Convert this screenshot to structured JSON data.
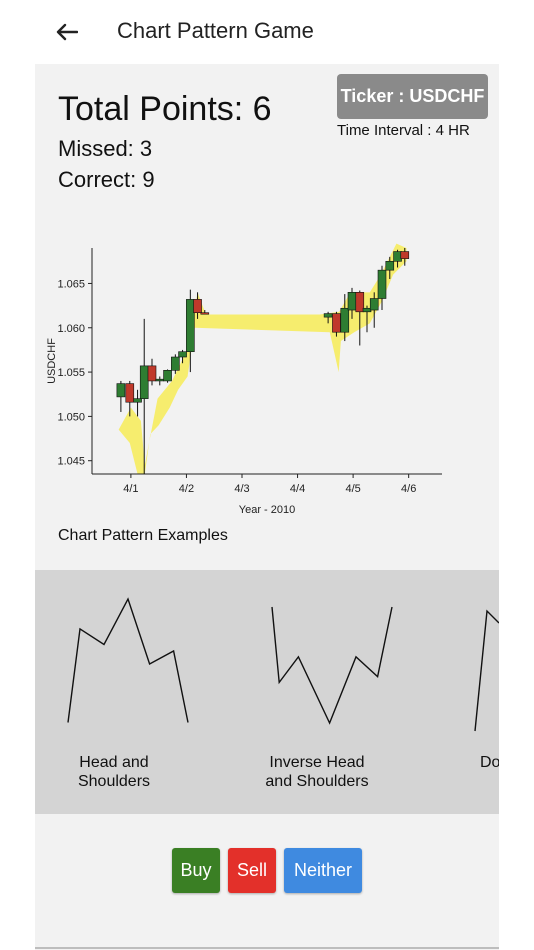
{
  "app": {
    "title": "Chart Pattern Game",
    "back_icon": "arrow-left-icon"
  },
  "score": {
    "total": "Total Points: 6",
    "missed": "Missed: 3",
    "correct": "Correct: 9"
  },
  "ticker": {
    "label": "Ticker : USDCHF",
    "interval": "Time Interval : 4 HR"
  },
  "colors": {
    "bull": "#2e7d32",
    "bear": "#c0392b",
    "highlight": "#f7ec57",
    "buy": "#3a7f24",
    "sell": "#e3302a",
    "neither": "#3f8ae0"
  },
  "chart_data": {
    "type": "candlestick",
    "xlabel": "Year - 2010",
    "ylabel": "USDCHF",
    "x_ticks": [
      "4/1",
      "4/2",
      "4/3",
      "4/4",
      "4/5",
      "4/6"
    ],
    "y_ticks": [
      "1.045",
      "1.050",
      "1.055",
      "1.060",
      "1.065"
    ],
    "ylim": [
      1.0435,
      1.069
    ],
    "xlim": [
      0.3,
      6.6
    ],
    "candles": [
      {
        "x": 0.82,
        "o": 1.0522,
        "h": 1.054,
        "l": 1.0505,
        "c": 1.0537
      },
      {
        "x": 0.98,
        "o": 1.0537,
        "h": 1.054,
        "l": 1.05,
        "c": 1.0516
      },
      {
        "x": 1.12,
        "o": 1.0516,
        "h": 1.053,
        "l": 1.05,
        "c": 1.052
      },
      {
        "x": 1.24,
        "o": 1.052,
        "h": 1.061,
        "l": 1.0435,
        "c": 1.0557
      },
      {
        "x": 1.38,
        "o": 1.0557,
        "h": 1.0565,
        "l": 1.0535,
        "c": 1.054
      },
      {
        "x": 1.52,
        "o": 1.054,
        "h": 1.0545,
        "l": 1.0535,
        "c": 1.0542
      },
      {
        "x": 1.66,
        "o": 1.054,
        "h": 1.0553,
        "l": 1.0538,
        "c": 1.0552
      },
      {
        "x": 1.8,
        "o": 1.0552,
        "h": 1.057,
        "l": 1.0548,
        "c": 1.0567
      },
      {
        "x": 1.93,
        "o": 1.0567,
        "h": 1.0575,
        "l": 1.056,
        "c": 1.0573
      },
      {
        "x": 2.07,
        "o": 1.0573,
        "h": 1.0643,
        "l": 1.055,
        "c": 1.0632
      },
      {
        "x": 2.2,
        "o": 1.0632,
        "h": 1.064,
        "l": 1.061,
        "c": 1.0617
      },
      {
        "x": 2.33,
        "o": 1.0617,
        "h": 1.062,
        "l": 1.0615,
        "c": 1.0616
      },
      {
        "x": 4.55,
        "o": 1.0612,
        "h": 1.0618,
        "l": 1.0605,
        "c": 1.0616
      },
      {
        "x": 4.7,
        "o": 1.0616,
        "h": 1.0618,
        "l": 1.059,
        "c": 1.0595
      },
      {
        "x": 4.85,
        "o": 1.0595,
        "h": 1.0638,
        "l": 1.0585,
        "c": 1.0622
      },
      {
        "x": 4.98,
        "o": 1.062,
        "h": 1.0645,
        "l": 1.061,
        "c": 1.064
      },
      {
        "x": 5.12,
        "o": 1.064,
        "h": 1.0642,
        "l": 1.058,
        "c": 1.0618
      },
      {
        "x": 5.25,
        "o": 1.0618,
        "h": 1.0625,
        "l": 1.0595,
        "c": 1.0622
      },
      {
        "x": 5.38,
        "o": 1.062,
        "h": 1.064,
        "l": 1.06,
        "c": 1.0633
      },
      {
        "x": 5.52,
        "o": 1.0633,
        "h": 1.067,
        "l": 1.062,
        "c": 1.0665
      },
      {
        "x": 5.66,
        "o": 1.0665,
        "h": 1.068,
        "l": 1.0655,
        "c": 1.0675
      },
      {
        "x": 5.8,
        "o": 1.0675,
        "h": 1.0688,
        "l": 1.0668,
        "c": 1.0686
      },
      {
        "x": 5.93,
        "o": 1.0686,
        "h": 1.069,
        "l": 1.067,
        "c": 1.0678
      }
    ],
    "highlight_band": {
      "upper": [
        [
          0.78,
          1.0485
        ],
        [
          1.0,
          1.051
        ],
        [
          1.18,
          1.0495
        ],
        [
          1.25,
          1.0445
        ],
        [
          1.48,
          1.052
        ],
        [
          1.74,
          1.054
        ],
        [
          2.05,
          1.058
        ],
        [
          2.2,
          1.064
        ],
        [
          2.35,
          1.0615
        ],
        [
          4.4,
          1.0615
        ],
        [
          4.75,
          1.0618
        ],
        [
          4.95,
          1.064
        ],
        [
          5.3,
          1.064
        ],
        [
          5.5,
          1.066
        ],
        [
          5.78,
          1.0695
        ],
        [
          5.96,
          1.069
        ]
      ],
      "lower": [
        [
          5.96,
          1.0675
        ],
        [
          5.72,
          1.066
        ],
        [
          5.52,
          1.063
        ],
        [
          5.3,
          1.0605
        ],
        [
          5.02,
          1.0595
        ],
        [
          4.78,
          1.0585
        ],
        [
          4.74,
          1.055
        ],
        [
          4.58,
          1.0595
        ],
        [
          2.15,
          1.06
        ],
        [
          2.02,
          1.0545
        ],
        [
          1.85,
          1.053
        ],
        [
          1.7,
          1.051
        ],
        [
          1.5,
          1.049
        ],
        [
          1.35,
          1.048
        ],
        [
          1.25,
          1.0435
        ],
        [
          1.12,
          1.0435
        ],
        [
          0.98,
          1.047
        ]
      ]
    }
  },
  "examples": {
    "title": "Chart Pattern Examples",
    "patterns": [
      {
        "label": "Head and Shoulders",
        "points": [
          [
            0,
            0.95
          ],
          [
            0.1,
            0.23
          ],
          [
            0.3,
            0.35
          ],
          [
            0.5,
            0.0
          ],
          [
            0.68,
            0.5
          ],
          [
            0.88,
            0.4
          ],
          [
            1.0,
            0.95
          ]
        ]
      },
      {
        "label": "Inverse Head and Shoulders",
        "points": [
          [
            0,
            0.0
          ],
          [
            0.06,
            0.65
          ],
          [
            0.22,
            0.43
          ],
          [
            0.48,
            1.0
          ],
          [
            0.7,
            0.43
          ],
          [
            0.88,
            0.6
          ],
          [
            1.0,
            0.0
          ]
        ]
      },
      {
        "label": "Do",
        "points": [
          [
            0,
            1.0
          ],
          [
            0.3,
            0.0
          ],
          [
            0.6,
            0.1
          ]
        ]
      }
    ]
  },
  "actions": {
    "buy": "Buy",
    "sell": "Sell",
    "neither": "Neither"
  }
}
